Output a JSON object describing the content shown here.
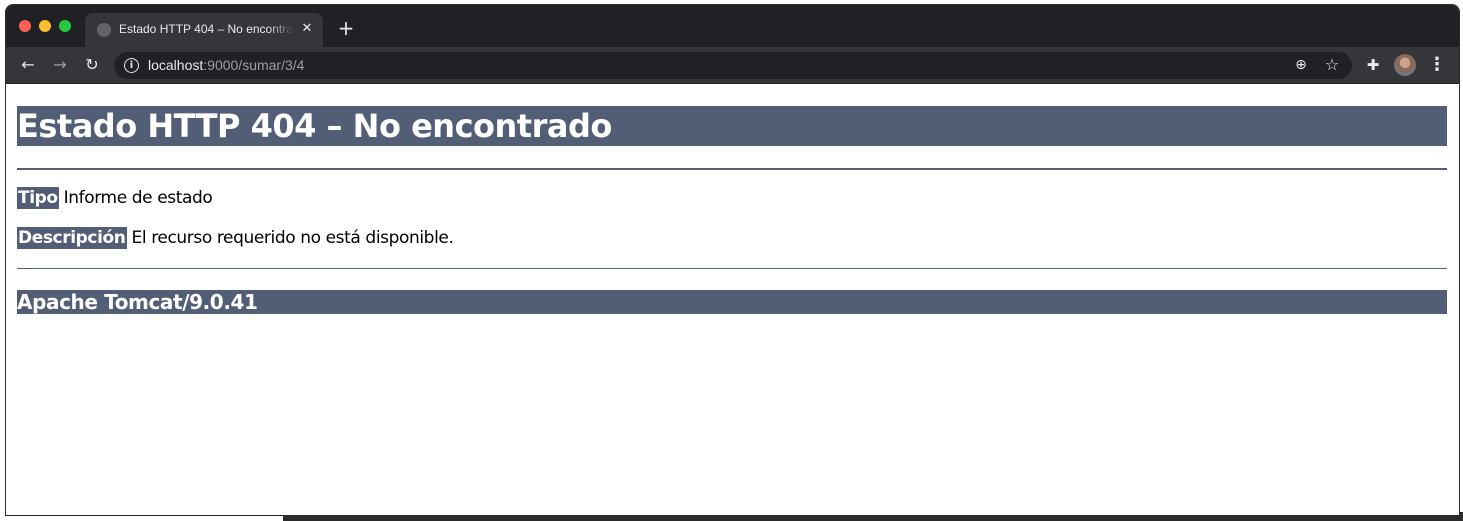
{
  "browser": {
    "tab_title": "Estado HTTP 404 – No encontrado",
    "url_host": "localhost",
    "url_path": ":9000/sumar/3/4",
    "icons": {
      "close": "close-icon",
      "new_tab": "plus-icon",
      "back": "back-arrow-icon",
      "forward": "forward-arrow-icon",
      "reload": "reload-icon",
      "info": "info-icon",
      "zoom": "zoom-icon",
      "bookmark": "star-icon",
      "extensions": "puzzle-icon",
      "menu": "kebab-menu-icon"
    }
  },
  "page": {
    "heading": "Estado HTTP 404 – No encontrado",
    "type_label": "Tipo",
    "type_value": " Informe de estado",
    "description_label": "Descripción",
    "description_value": " El recurso requerido no está disponible.",
    "server": "Apache Tomcat/9.0.41"
  },
  "colors": {
    "accent": "#525d76",
    "titlebar": "#202124",
    "toolbar": "#35363a"
  }
}
